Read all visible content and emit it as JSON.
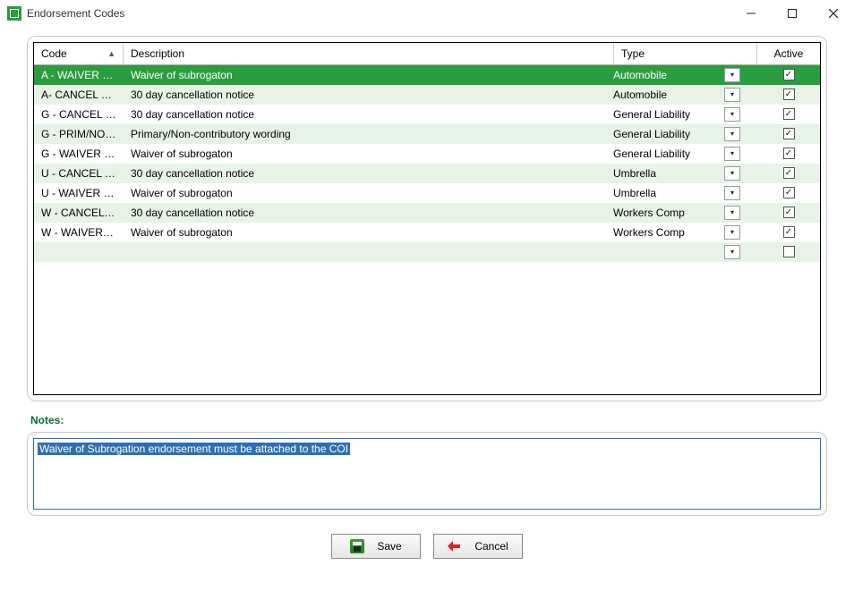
{
  "window": {
    "title": "Endorsement Codes"
  },
  "grid": {
    "headers": {
      "code": "Code",
      "description": "Description",
      "type": "Type",
      "active": "Active"
    },
    "rows": [
      {
        "code": "A - WAIVER OF ...",
        "description": "Waiver of subrogaton",
        "type": "Automobile",
        "active": true,
        "selected": true
      },
      {
        "code": "A- CANCEL NOTI...",
        "description": "30 day cancellation notice",
        "type": "Automobile",
        "active": true
      },
      {
        "code": "G - CANCEL NO...",
        "description": "30 day cancellation notice",
        "type": "General Liability",
        "active": true
      },
      {
        "code": "G - PRIM/NON C...",
        "description": "Primary/Non-contributory wording",
        "type": "General Liability",
        "active": true
      },
      {
        "code": "G - WAIVER OF ...",
        "description": "Waiver of subrogaton",
        "type": "General Liability",
        "active": true
      },
      {
        "code": "U - CANCEL NO...",
        "description": "30 day cancellation notice",
        "type": "Umbrella",
        "active": true
      },
      {
        "code": "U - WAIVER OF ...",
        "description": "Waiver of subrogaton",
        "type": "Umbrella",
        "active": true
      },
      {
        "code": "W - CANCEL NO...",
        "description": "30 day cancellation notice",
        "type": "Workers Comp",
        "active": true
      },
      {
        "code": "W - WAIVER OF ...",
        "description": "Waiver of subrogaton",
        "type": "Workers Comp",
        "active": true
      },
      {
        "code": "",
        "description": "",
        "type": "",
        "active": false
      }
    ]
  },
  "notes": {
    "label": "Notes:",
    "text": "Waiver of Subrogation endorsement must be attached to the COI"
  },
  "buttons": {
    "save": "Save",
    "cancel": "Cancel"
  }
}
